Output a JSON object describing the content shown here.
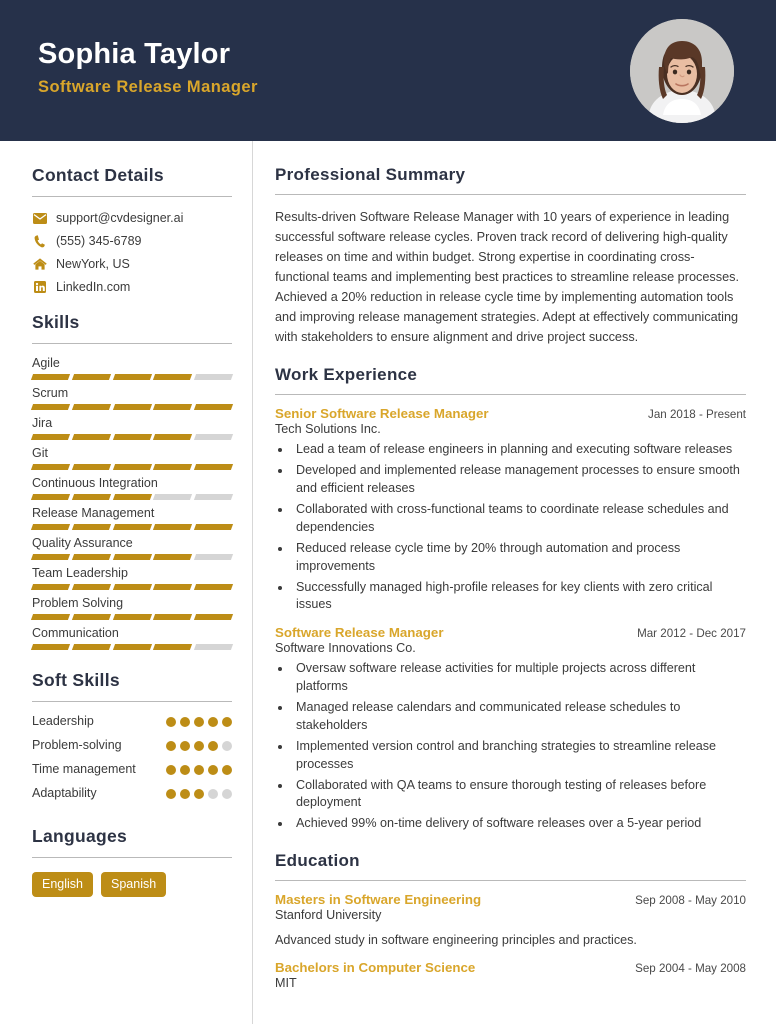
{
  "header": {
    "name": "Sophia Taylor",
    "job_title": "Software Release Manager",
    "avatar_label": "profile-photo",
    "bg_color": "#26314a",
    "accent_color": "#d9a62b"
  },
  "sidebar": {
    "contact": {
      "title": "Contact Details",
      "items": [
        {
          "icon": "envelope-icon",
          "value": "support@cvdesigner.ai"
        },
        {
          "icon": "phone-icon",
          "value": "(555) 345-6789"
        },
        {
          "icon": "home-icon",
          "value": "NewYork, US"
        },
        {
          "icon": "linkedin-icon",
          "value": "LinkedIn.com"
        }
      ]
    },
    "skills": {
      "title": "Skills",
      "max": 5,
      "items": [
        {
          "name": "Agile",
          "level": 4
        },
        {
          "name": "Scrum",
          "level": 5
        },
        {
          "name": "Jira",
          "level": 4
        },
        {
          "name": "Git",
          "level": 5
        },
        {
          "name": "Continuous Integration",
          "level": 3
        },
        {
          "name": "Release Management",
          "level": 5
        },
        {
          "name": "Quality Assurance",
          "level": 4
        },
        {
          "name": "Team Leadership",
          "level": 5
        },
        {
          "name": "Problem Solving",
          "level": 5
        },
        {
          "name": "Communication",
          "level": 4
        }
      ]
    },
    "soft_skills": {
      "title": "Soft Skills",
      "max": 5,
      "items": [
        {
          "name": "Leadership",
          "level": 5
        },
        {
          "name": "Problem-solving",
          "level": 4
        },
        {
          "name": "Time management",
          "level": 5
        },
        {
          "name": "Adaptability",
          "level": 3
        }
      ]
    },
    "languages": {
      "title": "Languages",
      "items": [
        "English",
        "Spanish"
      ]
    }
  },
  "main": {
    "summary": {
      "title": "Professional Summary",
      "text": "Results-driven Software Release Manager with 10 years of experience in leading successful software release cycles. Proven track record of delivering high-quality releases on time and within budget. Strong expertise in coordinating cross-functional teams and implementing best practices to streamline release processes. Achieved a 20% reduction in release cycle time by implementing automation tools and improving release management strategies. Adept at effectively communicating with stakeholders to ensure alignment and drive project success."
    },
    "work_experience": {
      "title": "Work Experience",
      "entries": [
        {
          "role": "Senior Software Release Manager",
          "date": "Jan 2018 - Present",
          "company": "Tech Solutions Inc.",
          "bullets": [
            "Lead a team of release engineers in planning and executing software releases",
            "Developed and implemented release management processes to ensure smooth and efficient releases",
            "Collaborated with cross-functional teams to coordinate release schedules and dependencies",
            "Reduced release cycle time by 20% through automation and process improvements",
            "Successfully managed high-profile releases for key clients with zero critical issues"
          ]
        },
        {
          "role": "Software Release Manager",
          "date": "Mar 2012 - Dec 2017",
          "company": "Software Innovations Co.",
          "bullets": [
            "Oversaw software release activities for multiple projects across different platforms",
            "Managed release calendars and communicated release schedules to stakeholders",
            "Implemented version control and branching strategies to streamline release processes",
            "Collaborated with QA teams to ensure thorough testing of releases before deployment",
            "Achieved 99% on-time delivery of software releases over a 5-year period"
          ]
        }
      ]
    },
    "education": {
      "title": "Education",
      "entries": [
        {
          "degree": "Masters in Software Engineering",
          "date": "Sep 2008 - May 2010",
          "school": "Stanford University",
          "description": "Advanced study in software engineering principles and practices."
        },
        {
          "degree": "Bachelors in Computer Science",
          "date": "Sep 2004 - May 2008",
          "school": "MIT",
          "description": ""
        }
      ]
    }
  }
}
